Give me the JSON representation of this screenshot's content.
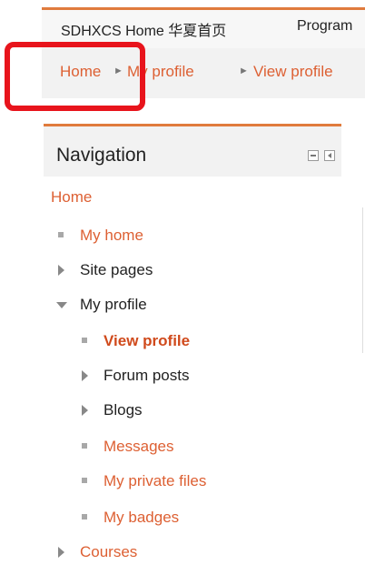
{
  "topbar": {
    "items": [
      "SDHXCS Home 华夏首页",
      "Program"
    ]
  },
  "breadcrumb": {
    "home": "Home",
    "my_profile": "My profile",
    "view_profile": "View profile",
    "separator": "►"
  },
  "navigation": {
    "title": "Navigation",
    "root": "Home",
    "items": [
      {
        "label": "My home",
        "type": "link"
      },
      {
        "label": "Site pages",
        "type": "collapsed"
      },
      {
        "label": "My profile",
        "type": "expanded"
      },
      {
        "label": "View profile",
        "type": "current"
      },
      {
        "label": "Forum posts",
        "type": "collapsed"
      },
      {
        "label": "Blogs",
        "type": "collapsed"
      },
      {
        "label": "Messages",
        "type": "link"
      },
      {
        "label": "My private files",
        "type": "link"
      },
      {
        "label": "My badges",
        "type": "link"
      },
      {
        "label": "Courses",
        "type": "collapsed"
      }
    ]
  },
  "colors": {
    "accent": "#e07b3d",
    "link": "#dd6033",
    "highlight": "#e8141c"
  }
}
